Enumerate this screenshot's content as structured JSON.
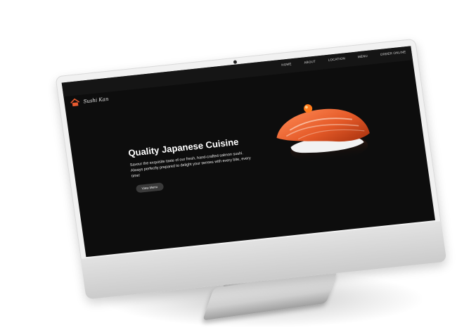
{
  "site": {
    "brand": "Sushi Kan",
    "nav": [
      "HOME",
      "ABOUT",
      "LOCATION",
      "MENU",
      "ORDER ONLINE"
    ],
    "hero": {
      "title": "Quality Japanese Cuisine",
      "description": "Savour the exquisite taste of our fresh, hand-crafted salmon sushi. Always perfectly prepared to delight your senses with every bite, every time!",
      "button": "View Menu"
    }
  },
  "colors": {
    "screen_bg": "#0d0d0d",
    "nav_bg": "#151515",
    "text": "#ffffff",
    "button_bg": "#3a3a3a",
    "device_frame": "#f1f1f1",
    "salmon": "#e85a2f"
  },
  "icons": [
    "house-icon"
  ],
  "images": [
    "salmon-sushi-image"
  ]
}
